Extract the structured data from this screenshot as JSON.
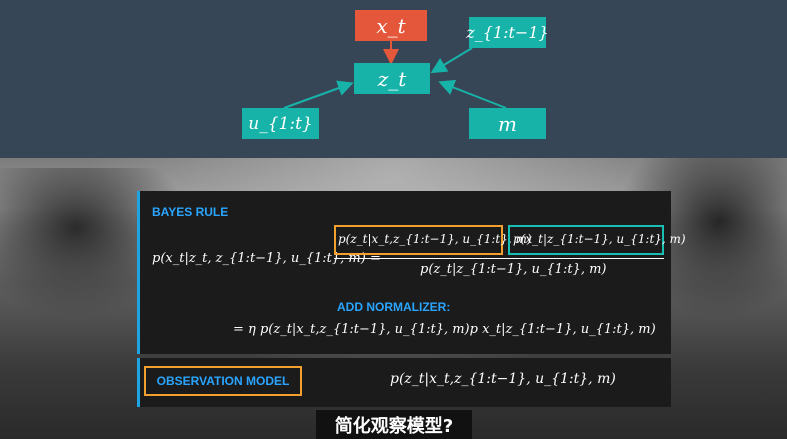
{
  "diagram": {
    "nodes": {
      "x_t": "x_t",
      "z_t": "z_t",
      "z_prev": "z_{1:t−1}",
      "u": "u_{1:t}",
      "m": "m"
    }
  },
  "panel": {
    "bayes_rule_header": "BAYES RULE",
    "lhs": "p(x_t|z_t, z_{1:t−1}, u_{1:t}, m) =",
    "numerator_observation": "p(z_t|x_t,z_{1:t−1}, u_{1:t}, m)",
    "numerator_prior": "p(x_t|z_{1:t−1}, u_{1:t}, m)",
    "denominator": "p(z_t|z_{1:t−1}, u_{1:t}, m)",
    "normalizer_header": "ADD NORMALIZER:",
    "normalized_expr": "= η p(z_t|x_t,z_{1:t−1}, u_{1:t}, m)p  x_t|z_{1:t−1}, u_{1:t}, m)"
  },
  "observation": {
    "label": "OBSERVATION MODEL",
    "expr": "p(z_t|x_t,z_{1:t−1}, u_{1:t}, m)"
  },
  "subtitle": "简化观察模型?",
  "colors": {
    "teal": "#17b3a8",
    "red": "#e4573b",
    "orange": "#f2a12e",
    "blue": "#2aa5ff"
  }
}
